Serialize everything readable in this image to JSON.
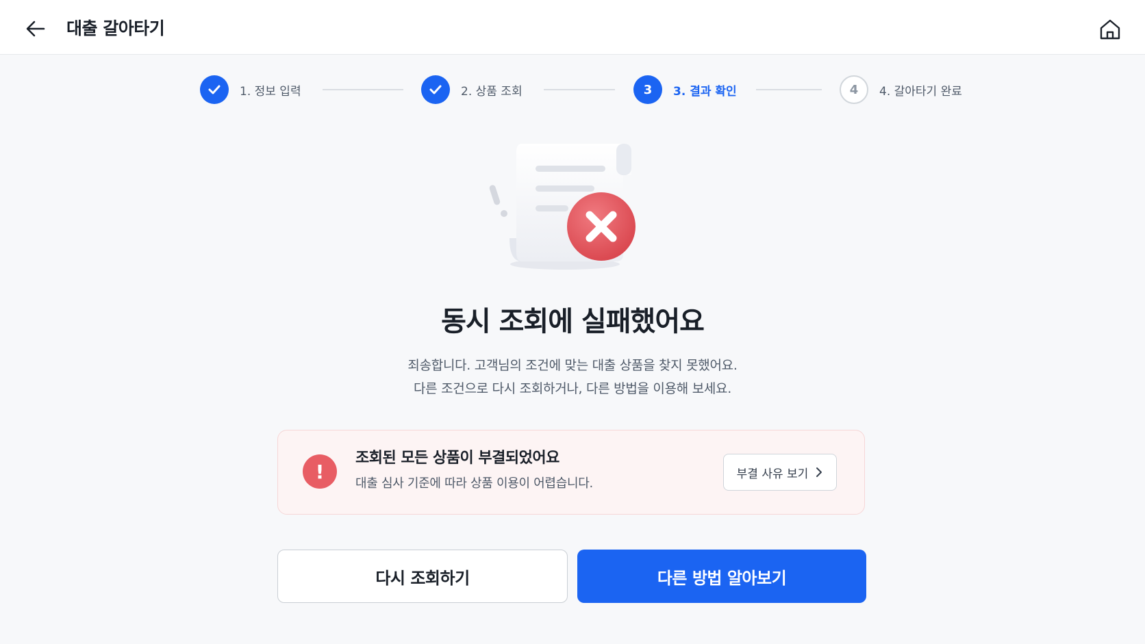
{
  "header": {
    "title": "대출 갈아타기",
    "back_icon": "arrow-left-icon",
    "home_icon": "home-icon"
  },
  "stepper": {
    "steps": [
      {
        "label": "1. 정보 입력",
        "number": "1",
        "status": "done"
      },
      {
        "label": "2. 상품 조회",
        "number": "2",
        "status": "done"
      },
      {
        "label": "3. 결과 확인",
        "number": "3",
        "status": "active"
      },
      {
        "label": "4. 갈아타기 완료",
        "number": "4",
        "status": "pending"
      }
    ]
  },
  "illustration": {
    "icon": "failed-document-icon"
  },
  "result": {
    "title": "동시 조회에 실패했어요",
    "desc_line1": "죄송합니다. 고객님의 조건에 맞는 대출 상품을 찾지 못했어요.",
    "desc_line2": "다른 조건으로 다시 조회하거나, 다른 방법을 이용해 보세요."
  },
  "alert": {
    "icon_text": "!",
    "title": "조회된 모든 상품이 부결되었어요",
    "subtitle": "대출 심사 기준에 따라 상품 이용이 어렵습니다.",
    "button_label": "부결 사유 보기"
  },
  "actions": {
    "retry_label": "다시 조회하기",
    "alternative_label": "다른 방법 알아보기"
  },
  "colors": {
    "primary": "#1b64f2",
    "error": "#e85d64",
    "alert_bg": "#fdf4f4"
  }
}
